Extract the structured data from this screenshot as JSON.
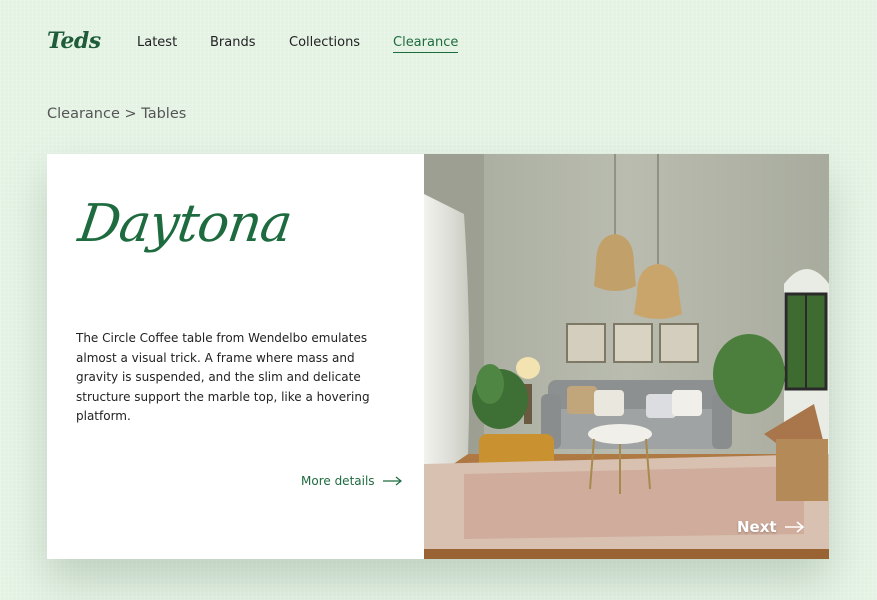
{
  "brand": {
    "logo_text": "Teds"
  },
  "nav": {
    "items": [
      {
        "label": "Latest"
      },
      {
        "label": "Brands"
      },
      {
        "label": "Collections"
      },
      {
        "label": "Clearance"
      }
    ],
    "active": "Clearance"
  },
  "breadcrumb": {
    "text": "Clearance > Tables"
  },
  "product": {
    "title": "Daytona",
    "description": "The Circle Coffee table from Wendelbo emulates almost a visual trick. A frame where mass and gravity is suspended, and the slim and delicate structure support the marble top, like a hovering platform.",
    "more_label": "More details"
  },
  "carousel": {
    "next_label": "Next"
  },
  "icons": {
    "arrow": "arrow-right-icon"
  },
  "colors": {
    "accent": "#1e6b3f",
    "background": "#e4f2e4"
  }
}
